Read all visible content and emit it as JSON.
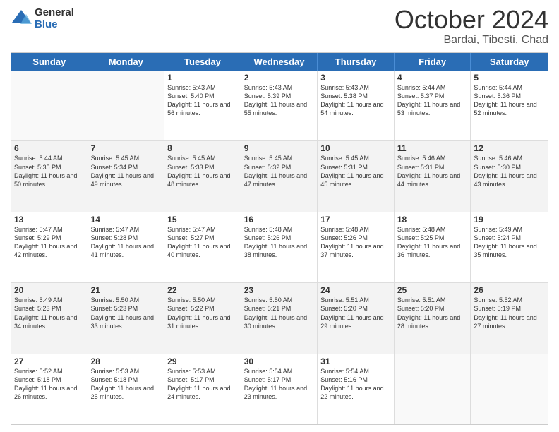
{
  "logo": {
    "general": "General",
    "blue": "Blue"
  },
  "header": {
    "month": "October 2024",
    "location": "Bardai, Tibesti, Chad"
  },
  "weekdays": [
    "Sunday",
    "Monday",
    "Tuesday",
    "Wednesday",
    "Thursday",
    "Friday",
    "Saturday"
  ],
  "weeks": [
    [
      {
        "day": "",
        "info": ""
      },
      {
        "day": "",
        "info": ""
      },
      {
        "day": "1",
        "info": "Sunrise: 5:43 AM\nSunset: 5:40 PM\nDaylight: 11 hours and 56 minutes."
      },
      {
        "day": "2",
        "info": "Sunrise: 5:43 AM\nSunset: 5:39 PM\nDaylight: 11 hours and 55 minutes."
      },
      {
        "day": "3",
        "info": "Sunrise: 5:43 AM\nSunset: 5:38 PM\nDaylight: 11 hours and 54 minutes."
      },
      {
        "day": "4",
        "info": "Sunrise: 5:44 AM\nSunset: 5:37 PM\nDaylight: 11 hours and 53 minutes."
      },
      {
        "day": "5",
        "info": "Sunrise: 5:44 AM\nSunset: 5:36 PM\nDaylight: 11 hours and 52 minutes."
      }
    ],
    [
      {
        "day": "6",
        "info": "Sunrise: 5:44 AM\nSunset: 5:35 PM\nDaylight: 11 hours and 50 minutes."
      },
      {
        "day": "7",
        "info": "Sunrise: 5:45 AM\nSunset: 5:34 PM\nDaylight: 11 hours and 49 minutes."
      },
      {
        "day": "8",
        "info": "Sunrise: 5:45 AM\nSunset: 5:33 PM\nDaylight: 11 hours and 48 minutes."
      },
      {
        "day": "9",
        "info": "Sunrise: 5:45 AM\nSunset: 5:32 PM\nDaylight: 11 hours and 47 minutes."
      },
      {
        "day": "10",
        "info": "Sunrise: 5:45 AM\nSunset: 5:31 PM\nDaylight: 11 hours and 45 minutes."
      },
      {
        "day": "11",
        "info": "Sunrise: 5:46 AM\nSunset: 5:31 PM\nDaylight: 11 hours and 44 minutes."
      },
      {
        "day": "12",
        "info": "Sunrise: 5:46 AM\nSunset: 5:30 PM\nDaylight: 11 hours and 43 minutes."
      }
    ],
    [
      {
        "day": "13",
        "info": "Sunrise: 5:47 AM\nSunset: 5:29 PM\nDaylight: 11 hours and 42 minutes."
      },
      {
        "day": "14",
        "info": "Sunrise: 5:47 AM\nSunset: 5:28 PM\nDaylight: 11 hours and 41 minutes."
      },
      {
        "day": "15",
        "info": "Sunrise: 5:47 AM\nSunset: 5:27 PM\nDaylight: 11 hours and 40 minutes."
      },
      {
        "day": "16",
        "info": "Sunrise: 5:48 AM\nSunset: 5:26 PM\nDaylight: 11 hours and 38 minutes."
      },
      {
        "day": "17",
        "info": "Sunrise: 5:48 AM\nSunset: 5:26 PM\nDaylight: 11 hours and 37 minutes."
      },
      {
        "day": "18",
        "info": "Sunrise: 5:48 AM\nSunset: 5:25 PM\nDaylight: 11 hours and 36 minutes."
      },
      {
        "day": "19",
        "info": "Sunrise: 5:49 AM\nSunset: 5:24 PM\nDaylight: 11 hours and 35 minutes."
      }
    ],
    [
      {
        "day": "20",
        "info": "Sunrise: 5:49 AM\nSunset: 5:23 PM\nDaylight: 11 hours and 34 minutes."
      },
      {
        "day": "21",
        "info": "Sunrise: 5:50 AM\nSunset: 5:23 PM\nDaylight: 11 hours and 33 minutes."
      },
      {
        "day": "22",
        "info": "Sunrise: 5:50 AM\nSunset: 5:22 PM\nDaylight: 11 hours and 31 minutes."
      },
      {
        "day": "23",
        "info": "Sunrise: 5:50 AM\nSunset: 5:21 PM\nDaylight: 11 hours and 30 minutes."
      },
      {
        "day": "24",
        "info": "Sunrise: 5:51 AM\nSunset: 5:20 PM\nDaylight: 11 hours and 29 minutes."
      },
      {
        "day": "25",
        "info": "Sunrise: 5:51 AM\nSunset: 5:20 PM\nDaylight: 11 hours and 28 minutes."
      },
      {
        "day": "26",
        "info": "Sunrise: 5:52 AM\nSunset: 5:19 PM\nDaylight: 11 hours and 27 minutes."
      }
    ],
    [
      {
        "day": "27",
        "info": "Sunrise: 5:52 AM\nSunset: 5:18 PM\nDaylight: 11 hours and 26 minutes."
      },
      {
        "day": "28",
        "info": "Sunrise: 5:53 AM\nSunset: 5:18 PM\nDaylight: 11 hours and 25 minutes."
      },
      {
        "day": "29",
        "info": "Sunrise: 5:53 AM\nSunset: 5:17 PM\nDaylight: 11 hours and 24 minutes."
      },
      {
        "day": "30",
        "info": "Sunrise: 5:54 AM\nSunset: 5:17 PM\nDaylight: 11 hours and 23 minutes."
      },
      {
        "day": "31",
        "info": "Sunrise: 5:54 AM\nSunset: 5:16 PM\nDaylight: 11 hours and 22 minutes."
      },
      {
        "day": "",
        "info": ""
      },
      {
        "day": "",
        "info": ""
      }
    ]
  ]
}
